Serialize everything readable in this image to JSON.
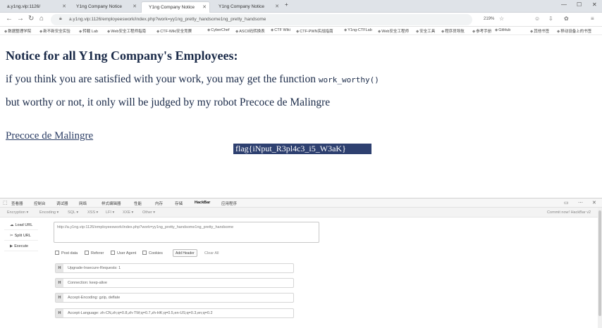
{
  "tabs": [
    {
      "label": "a.y1ng.vip:1126/",
      "active": false
    },
    {
      "label": "Y1ng Company Notice",
      "active": false
    },
    {
      "label": "Y1ng Company Notice",
      "active": true
    },
    {
      "label": "Y1ng Company Notice",
      "active": false
    }
  ],
  "address": {
    "url": "a.y1ng.vip:1126/employeeswork/index.php?work=yy1ng_pretty_handsome1ng_pretty_handsome",
    "zoom": "219%"
  },
  "bookmarks": [
    "数据整理学院",
    "新不新安全实验",
    "转载 Lab",
    "Web安全工程师指南",
    "CTF-Wiki安全竞赛",
    "CyberChef",
    "ASCII码转换表",
    "CTF Wiki",
    "CTF-PWN实战指南",
    "Y1ng-CTFLab",
    "Web安全工程师",
    "安全工具",
    "程序员导航",
    "参考手册",
    "GitHub",
    "其他书签",
    "移动设备上的书签"
  ],
  "page": {
    "heading": "Notice for all Y1ng Company's Employees:",
    "line1_text": "if you think you are satisfied with your work, you may get the function ",
    "line1_code": "work_worthy()",
    "line2": "but worthy or not, it only will be judged by my robot Precoce de Malingre",
    "link": "Precoce de Malingre",
    "flag": "flag{iNput_R3pl4c3_i5_W3aK}"
  },
  "devtools": {
    "tabs": [
      "查看器",
      "控制台",
      "调试器",
      "网络",
      "样式编辑器",
      "性能",
      "内存",
      "存储",
      "HackBar",
      "应用程序"
    ],
    "active_tab": "HackBar"
  },
  "hackbar": {
    "menu": [
      "Encryption ▾",
      "Encoding ▾",
      "SQL ▾",
      "XSS ▾",
      "LFI ▾",
      "XXE ▾",
      "Other ▾"
    ],
    "commit": "Commit now! HackBar v2",
    "load_url": "Load URL",
    "split_url": "Split URL",
    "execute": "Execute",
    "url_value": "http://a.y1ng.vip:1126/employeeswork/index.php?work=yy1ng_pretty_handsome1ng_pretty_handsome",
    "checks": [
      "Post data",
      "Referer",
      "User Agent",
      "Cookies"
    ],
    "add_header": "Add Header",
    "clear_all": "Clear All",
    "headers": [
      {
        "tag": "H",
        "value": "Upgrade-Insecure-Requests: 1"
      },
      {
        "tag": "H",
        "value": "Connection: keep-alive"
      },
      {
        "tag": "H",
        "value": "Accept-Encoding: gzip, deflate"
      },
      {
        "tag": "H",
        "value": "Accept-Language: zh-CN,zh;q=0.8,zh-TW;q=0.7,zh-HK;q=0.5,en-US;q=0.3,en;q=0.2"
      }
    ]
  }
}
